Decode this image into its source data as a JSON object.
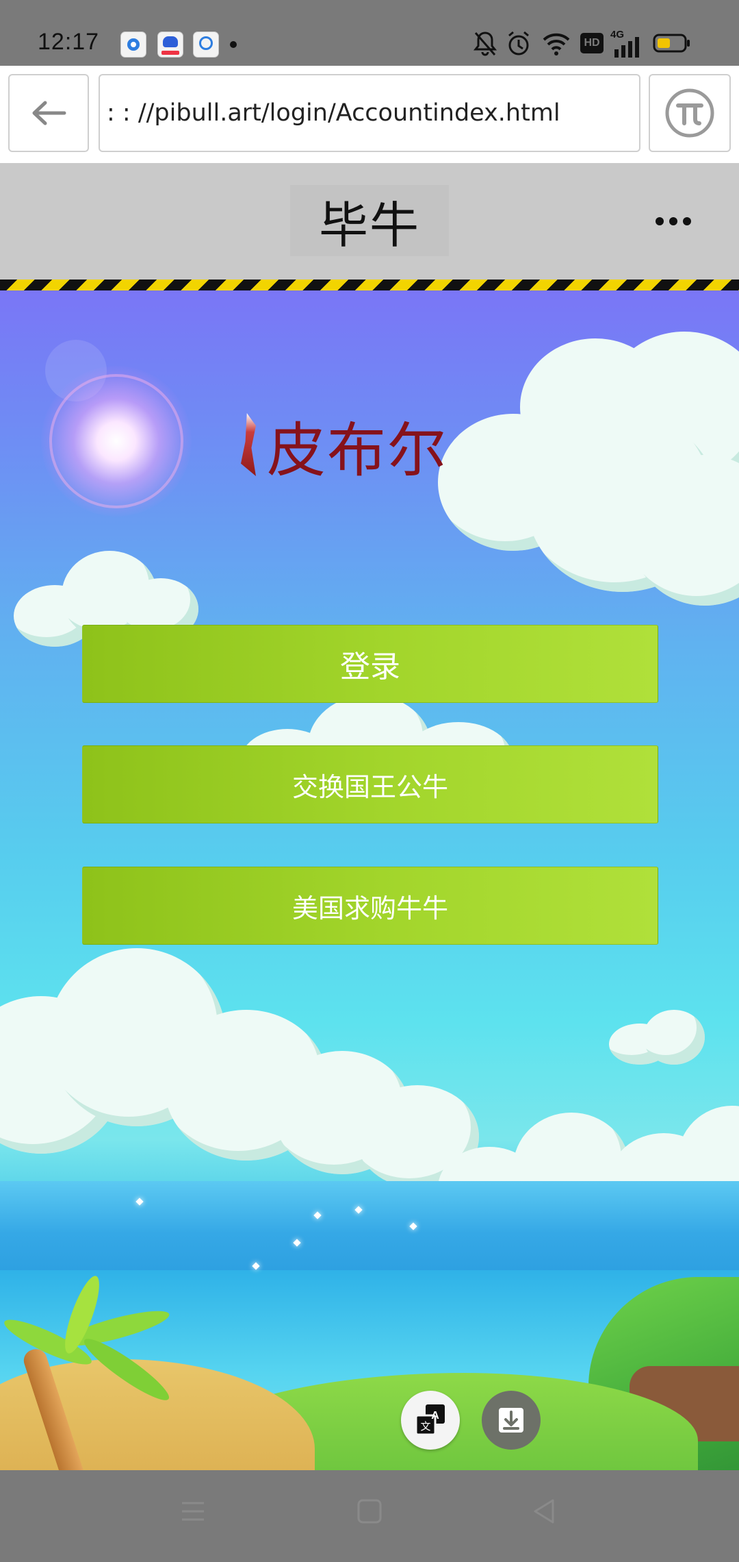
{
  "status_bar": {
    "time": "12:17",
    "network": "4G",
    "hd": "HD",
    "notification_icons": [
      "app-notification-icon",
      "baidu-icon",
      "baidu-netdisk-icon"
    ]
  },
  "browser": {
    "url": ": : //pibull.art/login/Accountindex.html"
  },
  "page": {
    "title": "毕牛",
    "more_menu_icon": "more-horizontal-icon"
  },
  "main": {
    "site_title": "皮布尔",
    "buttons": {
      "login": "登录",
      "exchange": "交换国王公牛",
      "buy": "美国求购牛牛"
    },
    "floating": {
      "translate_icon": "translate-icon",
      "translate_glyph_a": "A",
      "translate_glyph_zh": "文",
      "download_icon": "download-icon"
    }
  },
  "colors": {
    "button_green": "#a3d62c",
    "title_red": "#86121b",
    "hazard_yellow": "#f2d400"
  }
}
